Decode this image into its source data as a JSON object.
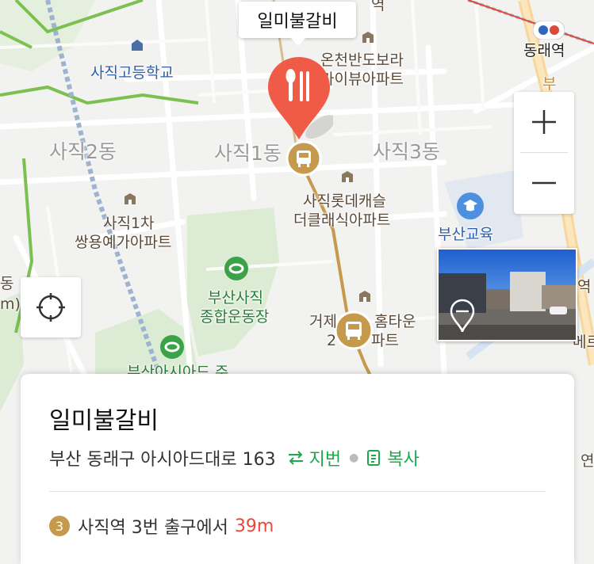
{
  "place_callout": "일미불갈비",
  "labels": {
    "top_partial": "역",
    "dongnae_station": "동래역",
    "samsung": "사직고등학교",
    "onchen": "온천반도보라",
    "onchen2": "카이뷰아파트",
    "sajik2": "사직2동",
    "sajik1": "사직1동",
    "sajik3": "사직3동",
    "lotte1": "사직롯데캐슬",
    "lotte2": "더클래식아파트",
    "ssangyong1": "사직1차",
    "ssangyong2": "쌍용예가아파트",
    "busan_edu": "부산교육",
    "stadium1": "부산사직",
    "stadium2": "종합운동장",
    "geoje1": "거제",
    "geoje1b": "홈타운",
    "geoje2": "2",
    "geoje2b": "파트",
    "asiad": "부산아시아드 주",
    "left_edge": "동",
    "left_edge2": "m)",
    "right_edge": "역",
    "right_edge2": "메르",
    "right_edge3": "연",
    "road_right": "부"
  },
  "controls": {
    "zoom_in": "zoom-in",
    "zoom_out": "zoom-out",
    "current_location": "current-location"
  },
  "card": {
    "title": "일미불갈비",
    "address": "부산 동래구 아시아드대로 163",
    "lot_toggle": "지번",
    "copy": "복사",
    "line_number": "3",
    "transit_text": "사직역 3번 출구에서",
    "distance": "39m"
  },
  "colors": {
    "pin_red": "#ef5b47",
    "subway_gold": "#c59a4c",
    "accent_green": "#1fa84b",
    "distance_red": "#e8473b",
    "park_green": "#dcecd4"
  }
}
